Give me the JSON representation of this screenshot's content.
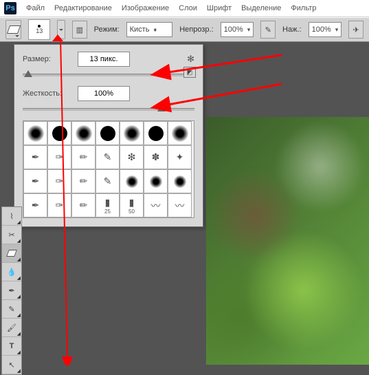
{
  "menu": {
    "file": "Файл",
    "edit": "Редактирование",
    "image": "Изображение",
    "layers": "Слои",
    "font": "Шрифт",
    "select": "Выделение",
    "filter": "Фильтр"
  },
  "optbar": {
    "brush_size": "13",
    "mode_label": "Режим:",
    "mode_value": "Кисть",
    "opacity_label": "Непрозр.:",
    "opacity_value": "100%",
    "flow_label": "Наж.:",
    "flow_value": "100%"
  },
  "panel": {
    "size_label": "Размер:",
    "size_value": "13 пикс.",
    "hardness_label": "Жесткость:",
    "hardness_value": "100%",
    "preset_labels": [
      "25",
      "50"
    ]
  }
}
